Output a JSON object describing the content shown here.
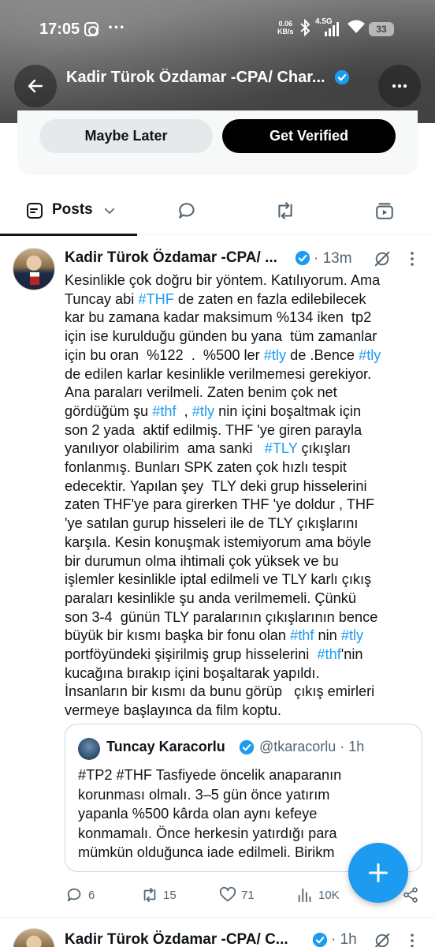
{
  "status_bar": {
    "time": "17:05",
    "dots": "···",
    "net_speed": "0.06",
    "net_unit": "KB/s",
    "signal_label": "4.5G",
    "battery": "33"
  },
  "header": {
    "title": "Kadir Türok Özdamar -CPA/ Char..."
  },
  "verify_card": {
    "maybe_label": "Maybe Later",
    "verify_label": "Get Verified"
  },
  "tabs": {
    "posts_label": "Posts"
  },
  "post": {
    "author": "Kadir Türok Özdamar -CPA/ ...",
    "time": "· 13m",
    "text_lines": [
      [
        [
          "t",
          "Kesinlikle çok doğru bir yöntem. Katılıyorum. Ama"
        ]
      ],
      [
        [
          "t",
          "Tuncay abi "
        ],
        [
          "h",
          "#THF"
        ],
        [
          "t",
          " de zaten en fazla edilebilecek"
        ]
      ],
      [
        [
          "t",
          "kar bu zamana kadar maksimum %134 iken  tp2"
        ]
      ],
      [
        [
          "t",
          "için ise kurulduğu günden bu yana  tüm zamanlar"
        ]
      ],
      [
        [
          "t",
          "için bu oran  %122  .  %500 ler "
        ],
        [
          "h",
          "#tly"
        ],
        [
          "t",
          " de .Bence "
        ],
        [
          "h",
          "#tly"
        ]
      ],
      [
        [
          "t",
          "de edilen karlar kesinlikle verilmemesi gerekiyor."
        ]
      ],
      [
        [
          "t",
          "Ana paraları verilmeli. Zaten benim çok net"
        ]
      ],
      [
        [
          "t",
          "gördüğüm şu "
        ],
        [
          "h",
          "#thf"
        ],
        [
          "t",
          "  , "
        ],
        [
          "h",
          "#tly"
        ],
        [
          "t",
          " nin içini boşaltmak için"
        ]
      ],
      [
        [
          "t",
          "son 2 yada  aktif edilmiş. THF 'ye giren parayla"
        ]
      ],
      [
        [
          "t",
          "yanılıyor olabilirim  ama sanki   "
        ],
        [
          "h",
          "#TLY"
        ],
        [
          "t",
          " çıkışları"
        ]
      ],
      [
        [
          "t",
          "fonlanmış. Bunları SPK zaten çok hızlı tespit"
        ]
      ],
      [
        [
          "t",
          "edecektir. Yapılan şey  TLY deki grup hisselerini"
        ]
      ],
      [
        [
          "t",
          "zaten THF'ye para girerken THF 'ye doldur , THF"
        ]
      ],
      [
        [
          "t",
          "'ye satılan gurup hisseleri ile de TLY çıkışlarını"
        ]
      ],
      [
        [
          "t",
          "karşıla. Kesin konuşmak istemiyorum ama böyle"
        ]
      ],
      [
        [
          "t",
          "bir durumun olma ihtimali çok yüksek ve bu"
        ]
      ],
      [
        [
          "t",
          "işlemler kesinlikle iptal edilmeli ve TLY karlı çıkış"
        ]
      ],
      [
        [
          "t",
          "paraları kesinlikle şu anda verilmemeli. Çünkü"
        ]
      ],
      [
        [
          "t",
          "son 3-4  günün TLY paralarının çıkışlarının bence"
        ]
      ],
      [
        [
          "t",
          "büyük bir kısmı başka bir fonu olan "
        ],
        [
          "h",
          "#thf"
        ],
        [
          "t",
          " nin "
        ],
        [
          "h",
          "#tly"
        ]
      ],
      [
        [
          "t",
          "portföyündeki şişirilmiş grup hisselerini  "
        ],
        [
          "h",
          "#thf"
        ],
        [
          "t",
          "'nin"
        ]
      ],
      [
        [
          "t",
          "kucağına bırakıp içini boşaltarak yapıldı."
        ]
      ],
      [
        [
          "t",
          "İnsanların bir kısmı da bunu görüp   çıkış emirleri"
        ]
      ],
      [
        [
          "t",
          "vermeye başlayınca da film koptu."
        ]
      ]
    ],
    "quote": {
      "author": "Tuncay Karacorlu",
      "handle": "@tkaracorlu · 1h",
      "text": "#TP2 #THF Tasfiyede öncelik anaparanın\nkorunması olmalı. 3–5 gün önce yatırım\nyapanla %500 kârda olan aynı kefeye\nkonmamalı. Önce herkesin yatırdığı para\nmümkün olduğunca iade edilmeli. Birikm"
    },
    "actions": {
      "replies": "6",
      "reposts": "15",
      "likes": "71",
      "views": "10K"
    }
  },
  "next_post": {
    "author": "Kadir Türok Özdamar -CPA/ C...",
    "time": "· 1h"
  },
  "colors": {
    "accent": "#1d9bf0",
    "text": "#0f1419",
    "muted": "#536471"
  }
}
